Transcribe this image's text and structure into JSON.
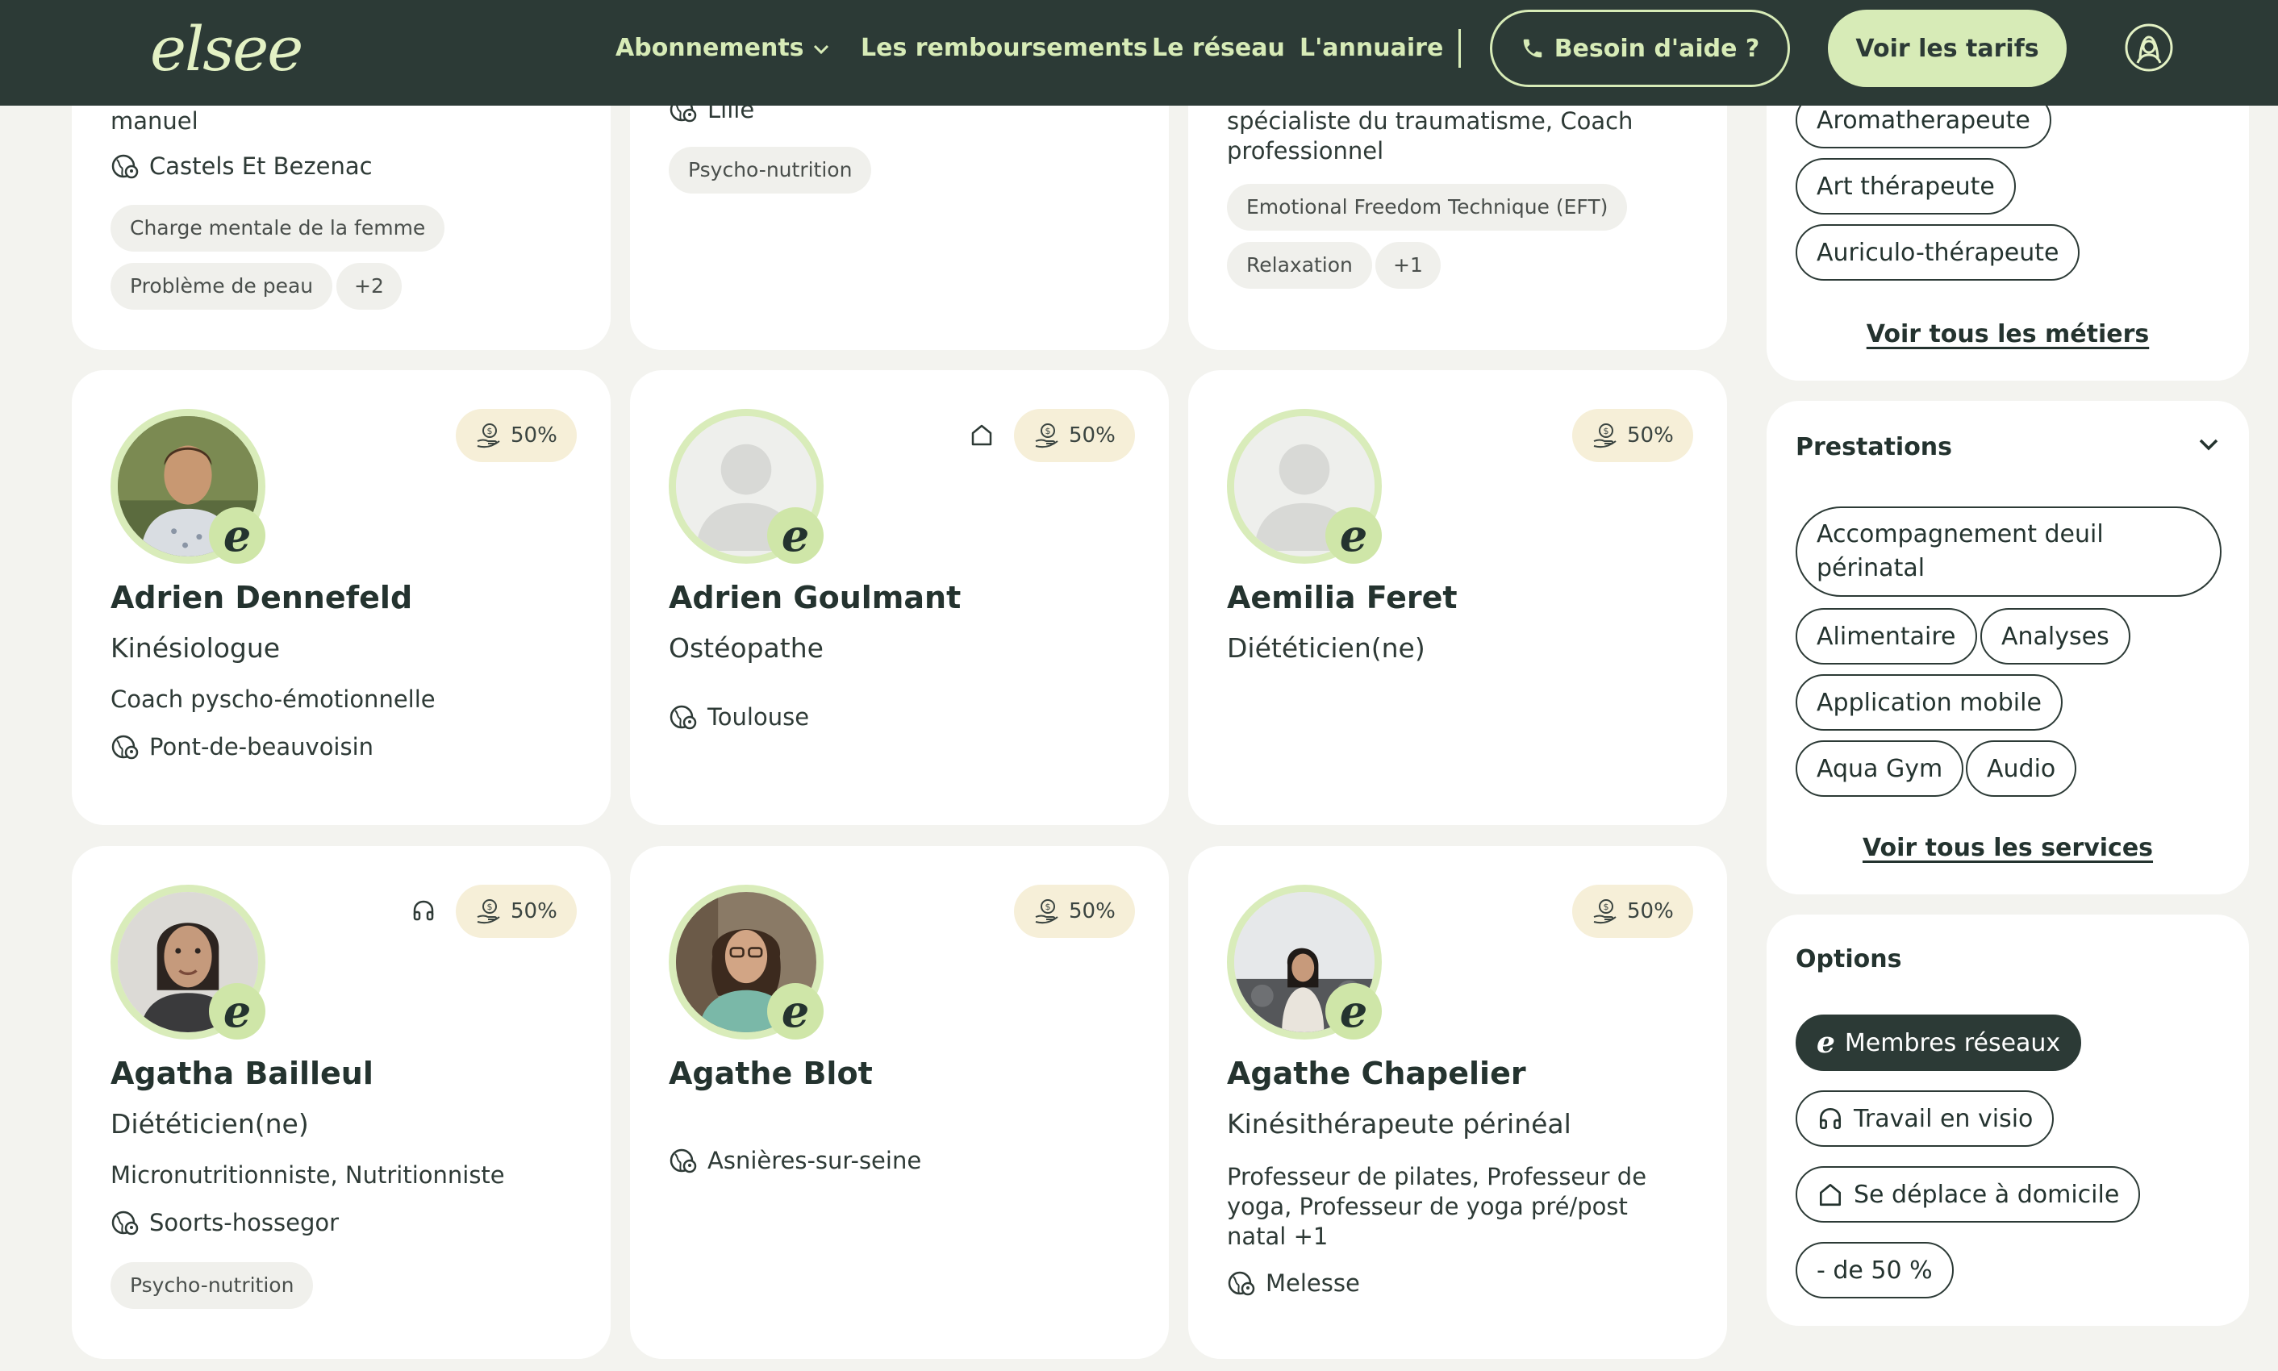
{
  "nav": {
    "logo": "elsee",
    "links": [
      "Abonnements",
      "Les remboursements",
      "Le réseau",
      "L'annuaire"
    ],
    "help_label": "Besoin d'aide ?",
    "tarifs_label": "Voir les tarifs",
    "colors": {
      "nav_bg": "#2c3a36",
      "accent": "#d7ebb7"
    }
  },
  "top_cards": [
    {
      "text": "manuel",
      "location": "Castels Et Bezenac",
      "tags": [
        "Charge mentale de la femme",
        "Problème de peau",
        "+2"
      ]
    },
    {
      "location": "Lille",
      "tags": [
        "Psycho-nutrition"
      ]
    },
    {
      "text": "spécialiste du traumatisme, Coach professionnel",
      "tags": [
        "Emotional Freedom Technique (EFT)",
        "Relaxation",
        "+1"
      ]
    }
  ],
  "cards": [
    {
      "name": "Adrien Dennefeld",
      "job": "Kinésiologue",
      "specialties": "Coach pyscho-émotionnelle",
      "location": "Pont-de-beauvoisin",
      "reimbursement": "50%",
      "tags": []
    },
    {
      "name": "Adrien Goulmant",
      "job": "Ostéopathe",
      "specialties": "",
      "location": "Toulouse",
      "reimbursement": "50%",
      "home_visit": true,
      "tags": []
    },
    {
      "name": "Aemilia Feret",
      "job": "Diététicien(ne)",
      "specialties": "",
      "location": "",
      "reimbursement": "50%",
      "tags": []
    },
    {
      "name": "Agatha Bailleul",
      "job": "Diététicien(ne)",
      "specialties": "Micronutritionniste, Nutritionniste",
      "location": "Soorts-hossegor",
      "reimbursement": "50%",
      "video": true,
      "tags": [
        "Psycho-nutrition"
      ]
    },
    {
      "name": "Agathe Blot",
      "job": "",
      "specialties": "",
      "location": "Asnières-sur-seine",
      "reimbursement": "50%",
      "tags": []
    },
    {
      "name": "Agathe Chapelier",
      "job": "Kinésithérapeute périnéal",
      "specialties": "Professeur de pilates, Professeur de yoga, Professeur de yoga pré/post natal +1",
      "location": "Melesse",
      "reimbursement": "50%",
      "tags": []
    }
  ],
  "sidebar": {
    "metiers": {
      "items": [
        "Aromatherapeute",
        "Art thérapeute",
        "Auriculo-thérapeute"
      ],
      "link": "Voir tous les métiers"
    },
    "prestations": {
      "title": "Prestations",
      "items": [
        "Accompagnement deuil périnatal",
        "Alimentaire",
        "Analyses",
        "Application mobile",
        "Aqua Gym",
        "Audio"
      ],
      "link": "Voir tous les services"
    },
    "options": {
      "title": "Options",
      "items": [
        "Membres réseaux",
        "Travail en visio",
        "Se déplace à domicile",
        "- de 50 %"
      ]
    }
  }
}
